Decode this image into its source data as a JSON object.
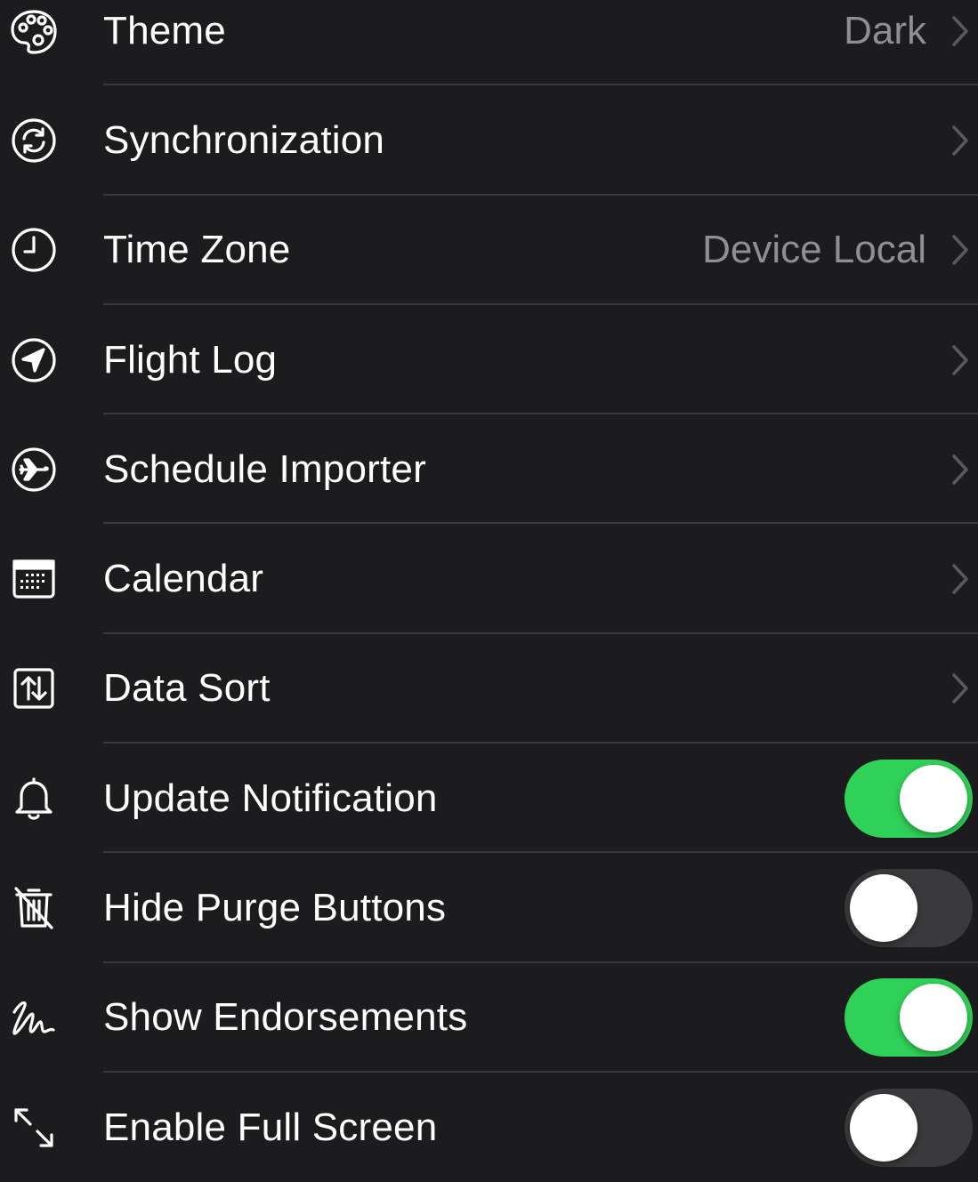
{
  "settings": {
    "theme": {
      "label": "Theme",
      "value": "Dark",
      "icon": "palette-icon"
    },
    "synchronization": {
      "label": "Synchronization",
      "icon": "sync-icon"
    },
    "time_zone": {
      "label": "Time Zone",
      "value": "Device Local",
      "icon": "clock-icon"
    },
    "flight_log": {
      "label": "Flight Log",
      "icon": "navigation-arrow-icon"
    },
    "schedule_importer": {
      "label": "Schedule Importer",
      "icon": "airplane-circle-icon"
    },
    "calendar": {
      "label": "Calendar",
      "icon": "calendar-icon"
    },
    "data_sort": {
      "label": "Data Sort",
      "icon": "sort-arrows-icon"
    },
    "update_notification": {
      "label": "Update Notification",
      "icon": "bell-icon",
      "enabled": true
    },
    "hide_purge_buttons": {
      "label": "Hide Purge Buttons",
      "icon": "trash-slash-icon",
      "enabled": false
    },
    "show_endorsements": {
      "label": "Show Endorsements",
      "icon": "signature-icon",
      "enabled": true
    },
    "enable_full_screen": {
      "label": "Enable Full Screen",
      "icon": "expand-arrows-icon",
      "enabled": false
    }
  },
  "colors": {
    "background": "#1c1c1e",
    "separator": "#38383a",
    "toggle_on": "#30d158",
    "toggle_off": "#3a3a3c",
    "secondary_text": "#8e8e93",
    "chevron": "#5a5a5e"
  }
}
